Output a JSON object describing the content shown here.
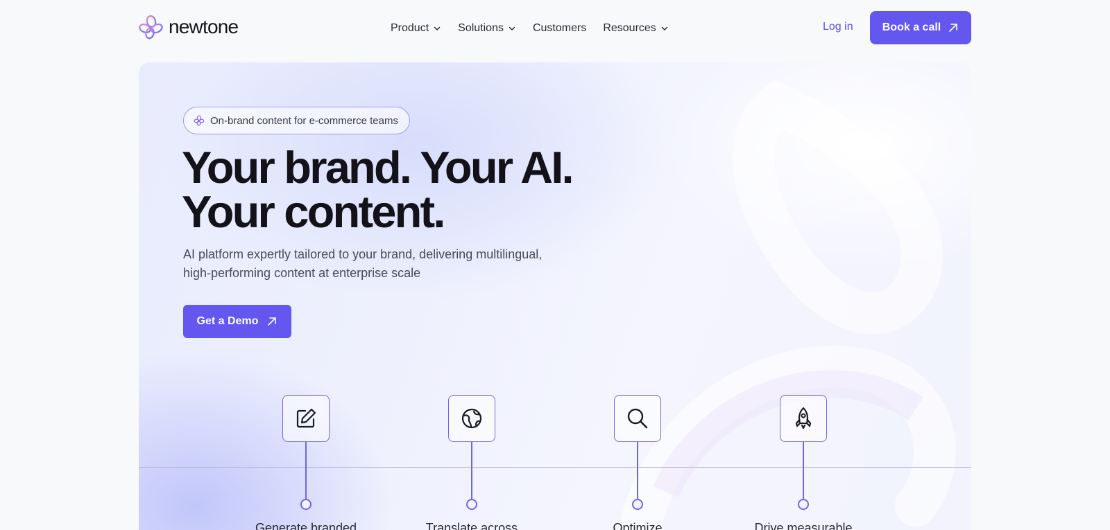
{
  "brand": {
    "name": "newtone",
    "accent": "#6357ef"
  },
  "nav": {
    "items": [
      {
        "label": "Product",
        "has_dropdown": true
      },
      {
        "label": "Solutions",
        "has_dropdown": true
      },
      {
        "label": "Customers",
        "has_dropdown": false
      },
      {
        "label": "Resources",
        "has_dropdown": true
      }
    ],
    "login_label": "Log in",
    "cta_label": "Book a call"
  },
  "hero": {
    "badge": "On-brand content for e-commerce teams",
    "headline_line1": "Your brand. Your AI.",
    "headline_line2": "Your content.",
    "subtitle_line1": "AI platform expertly tailored to your brand, delivering multilingual,",
    "subtitle_line2": "high-performing content at enterprise scale",
    "cta_label": "Get a Demo"
  },
  "features": [
    {
      "icon": "edit-icon",
      "label": "Generate branded"
    },
    {
      "icon": "globe-icon",
      "label": "Translate across"
    },
    {
      "icon": "search-icon",
      "label": "Optimize"
    },
    {
      "icon": "rocket-icon",
      "label": "Drive measurable"
    }
  ]
}
